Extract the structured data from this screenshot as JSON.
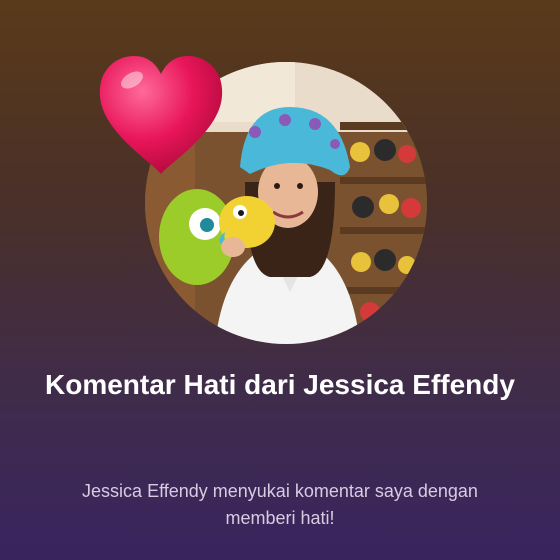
{
  "notification": {
    "title": "Komentar Hati dari Jessica Effendy",
    "message": "Jessica Effendy menyukai komentar saya dengan memberi hati!",
    "avatar_icon": "profile-photo",
    "reaction_icon": "heart-balloon-icon"
  },
  "colors": {
    "heart": "#e8155a",
    "title_text": "#ffffff",
    "message_text": "#d9cbe0",
    "bg_top": "#5a3a1a",
    "bg_bottom": "#3a2460"
  }
}
